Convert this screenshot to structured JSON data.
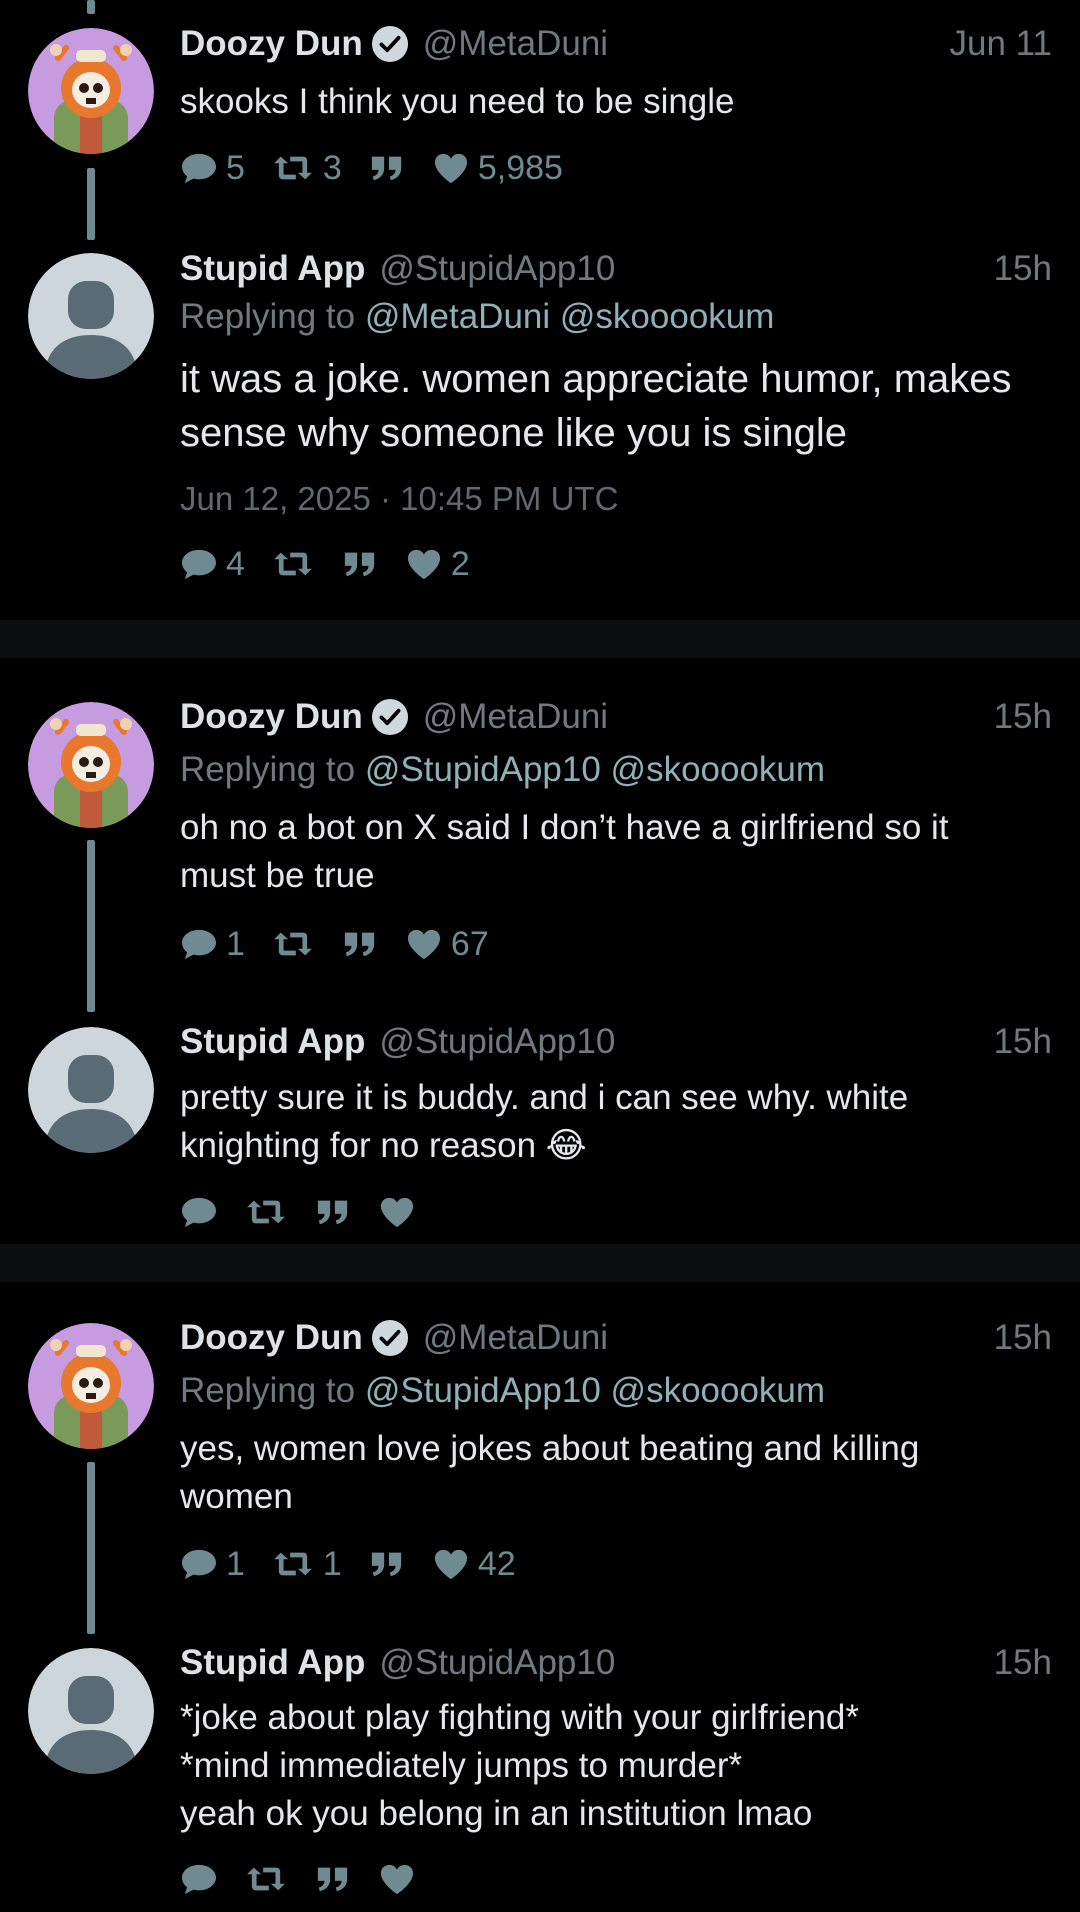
{
  "tweets": [
    {
      "name": "Doozy Dun",
      "verified": true,
      "handle": "@MetaDuni",
      "time": "Jun 11",
      "replying": null,
      "text": [
        "skooks I think you need to be single"
      ],
      "stats": {
        "replies": "5",
        "retweets": "3",
        "quotes": "",
        "likes": "5,985"
      }
    },
    {
      "name": "Stupid App",
      "verified": false,
      "handle": "@StupidApp10",
      "time": "15h",
      "replying": {
        "prefix": "Replying to",
        "mentions": "@MetaDuni @skooookum"
      },
      "text": [
        "it was a joke. women appreciate humor, makes",
        "sense why someone like you is single"
      ],
      "timestamp": "Jun 12, 2025 · 10:45 PM UTC",
      "stats": {
        "replies": "4",
        "retweets": "",
        "quotes": "",
        "likes": "2"
      }
    },
    {
      "name": "Doozy Dun",
      "verified": true,
      "handle": "@MetaDuni",
      "time": "15h",
      "replying": {
        "prefix": "Replying to",
        "mentions": "@StupidApp10 @skooookum"
      },
      "text": [
        "oh no a bot on X said I don’t have a girlfriend so it",
        "must be true"
      ],
      "stats": {
        "replies": "1",
        "retweets": "",
        "quotes": "",
        "likes": "67"
      }
    },
    {
      "name": "Stupid App",
      "verified": false,
      "handle": "@StupidApp10",
      "time": "15h",
      "replying": null,
      "text": [
        "pretty sure it is buddy. and i can see why. white",
        "knighting for no reason 😂"
      ],
      "stats": {
        "replies": "",
        "retweets": "",
        "quotes": "",
        "likes": ""
      }
    },
    {
      "name": "Doozy Dun",
      "verified": true,
      "handle": "@MetaDuni",
      "time": "15h",
      "replying": {
        "prefix": "Replying to",
        "mentions": "@StupidApp10 @skooookum"
      },
      "text": [
        "yes, women love jokes about beating and killing",
        "women"
      ],
      "stats": {
        "replies": "1",
        "retweets": "1",
        "quotes": "",
        "likes": "42"
      }
    },
    {
      "name": "Stupid App",
      "verified": false,
      "handle": "@StupidApp10",
      "time": "15h",
      "replying": null,
      "text": [
        "*joke about play fighting with your girlfriend*",
        "*mind immediately jumps to murder*",
        "yeah ok you belong in an institution lmao"
      ],
      "stats": {
        "replies": "",
        "retweets": "",
        "quotes": "",
        "likes": ""
      }
    }
  ],
  "icons": [
    "comment-icon",
    "retweet-icon",
    "quote-icon",
    "heart-icon",
    "verified-icon"
  ],
  "colors": {
    "background": "#000000",
    "muted": "#6f7a80",
    "accent": "#8fb0b8",
    "thread": "#6c8a90"
  }
}
